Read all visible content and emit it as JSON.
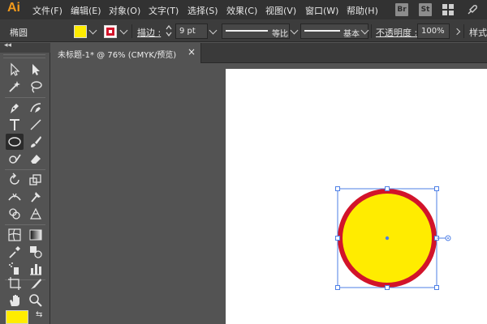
{
  "app": {
    "logo": "Ai"
  },
  "menu": {
    "items": [
      "文件(F)",
      "编辑(E)",
      "对象(O)",
      "文字(T)",
      "选择(S)",
      "效果(C)",
      "视图(V)",
      "窗口(W)",
      "帮助(H)"
    ],
    "bridge_badge": "Br",
    "stock_badge": "St"
  },
  "control_bar": {
    "object_type": "椭圆",
    "fill_color": "#ffec00",
    "stroke_color": "#d2142a",
    "stroke_label": "描边 :",
    "stroke_weight": "9 pt",
    "profile_label": "等比",
    "brush_label": "基本",
    "opacity_label": "不透明度 :",
    "opacity_value": "100%",
    "style_label": "样式"
  },
  "document": {
    "tab_label": "未标题-1* @ 76% (CMYK/预览)",
    "tab_close": "×"
  },
  "toolbar": {
    "collapse_label": "◂◂",
    "active_tool": "ellipse-tool",
    "fill_color": "#ffec00",
    "swap_label": "⇆"
  },
  "artwork": {
    "shape": "ellipse",
    "fill_color": "#ffec00",
    "stroke_color": "#d2142a",
    "selection_color": "#4d7fe6"
  }
}
